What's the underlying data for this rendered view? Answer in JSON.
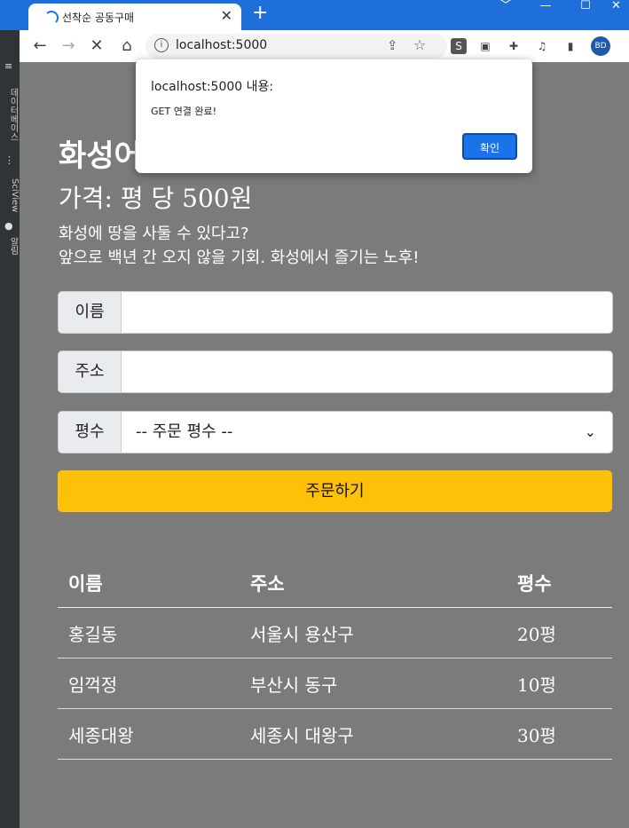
{
  "browser": {
    "tab_title": "선착순 공동구매",
    "tab_close": "✕",
    "new_tab": "+",
    "url": "localhost:5000",
    "profile_initials": "BD",
    "extension_s": "S",
    "window_controls": [
      "﹀",
      "—",
      "☐",
      "✕"
    ]
  },
  "side_panel": {
    "items": [
      "데이터베이스",
      "SciView",
      "알림"
    ]
  },
  "page": {
    "heading": "화성어",
    "price": "가격: 평 당 500원",
    "description_line1": "화성에 땅을 사둘 수 있다고?",
    "description_line2": "앞으로 백년 간 오지 않을 기회. 화성에서 즐기는 노후!"
  },
  "form": {
    "name_label": "이름",
    "address_label": "주소",
    "size_label": "평수",
    "size_selected": "-- 주문 평수 --",
    "order_button": "주문하기"
  },
  "table": {
    "headers": [
      "이름",
      "주소",
      "평수"
    ],
    "rows": [
      [
        "홍길동",
        "서울시 용산구",
        "20평"
      ],
      [
        "임꺽정",
        "부산시 동구",
        "10평"
      ],
      [
        "세종대왕",
        "세종시 대왕구",
        "30평"
      ]
    ]
  },
  "dialog": {
    "title": "localhost:5000 내용:",
    "message": "GET 연결 완료!",
    "ok_button": "확인"
  }
}
